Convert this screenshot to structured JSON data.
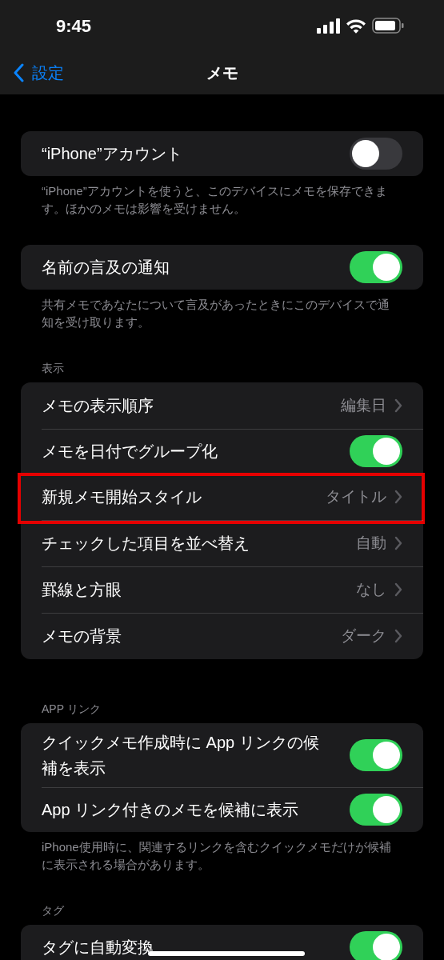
{
  "status_bar": {
    "time": "9:45"
  },
  "nav": {
    "back": "設定",
    "title": "メモ"
  },
  "sections": [
    {
      "rows": [
        {
          "kind": "toggle",
          "label": "“iPhone”アカウント",
          "on": false,
          "highlighted": false
        }
      ],
      "footer": "“iPhone”アカウントを使うと、このデバイスにメモを保存できます。ほかのメモは影響を受けません。"
    },
    {
      "rows": [
        {
          "kind": "toggle",
          "label": "名前の言及の通知",
          "on": true,
          "highlighted": false
        }
      ],
      "footer": "共有メモであなたについて言及があったときにこのデバイスで通知を受け取ります。"
    },
    {
      "header": "表示",
      "rows": [
        {
          "kind": "value",
          "label": "メモの表示順序",
          "value": "編集日",
          "highlighted": false
        },
        {
          "kind": "toggle",
          "label": "メモを日付でグループ化",
          "on": true,
          "highlighted": false
        },
        {
          "kind": "value",
          "label": "新規メモ開始スタイル",
          "value": "タイトル",
          "highlighted": true
        },
        {
          "kind": "value",
          "label": "チェックした項目を並べ替え",
          "value": "自動",
          "highlighted": false
        },
        {
          "kind": "value",
          "label": "罫線と方眼",
          "value": "なし",
          "highlighted": false
        },
        {
          "kind": "value",
          "label": "メモの背景",
          "value": "ダーク",
          "highlighted": false
        }
      ]
    },
    {
      "header": "APP リンク",
      "rows": [
        {
          "kind": "toggle",
          "label": "クイックメモ作成時に App リンクの候補を表示",
          "on": true,
          "highlighted": false
        },
        {
          "kind": "toggle",
          "label": "App リンク付きのメモを候補に表示",
          "on": true,
          "highlighted": false
        }
      ],
      "footer": "iPhone使用時に、関連するリンクを含むクイックメモだけが候補に表示される場合があります。"
    },
    {
      "header": "タグ",
      "rows": [
        {
          "kind": "toggle",
          "label": "タグに自動変換",
          "on": true,
          "highlighted": false
        }
      ]
    }
  ]
}
